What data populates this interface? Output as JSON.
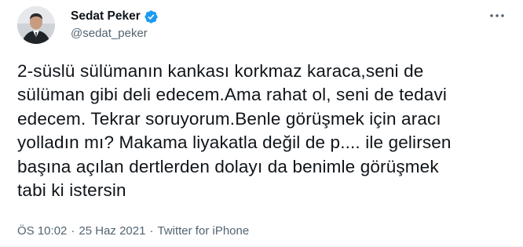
{
  "tweet": {
    "author": {
      "display_name": "Sedat Peker",
      "handle": "@sedat_peker",
      "verified": true,
      "avatar_icon": "profile-photo-icon"
    },
    "text": "2-süslü sülümanın kankası korkmaz karaca,seni de\nsülüman gibi deli edecem.Ama rahat ol, seni de tedavi\nedecem. Tekrar soruyorum.Benle görüşmek için aracı\nyolladın mı? Makama liyakatla değil de p.... ile gelirsen\nbaşına açılan dertlerden dolayı da benimle görüşmek\ntabi ki istersin",
    "time": "ÖS 10:02",
    "separator": "·",
    "date": "25 Haz 2021",
    "source": "Twitter for iPhone"
  },
  "colors": {
    "text_primary": "#0f1419",
    "text_secondary": "#536471",
    "verified_blue": "#1d9bf0"
  }
}
